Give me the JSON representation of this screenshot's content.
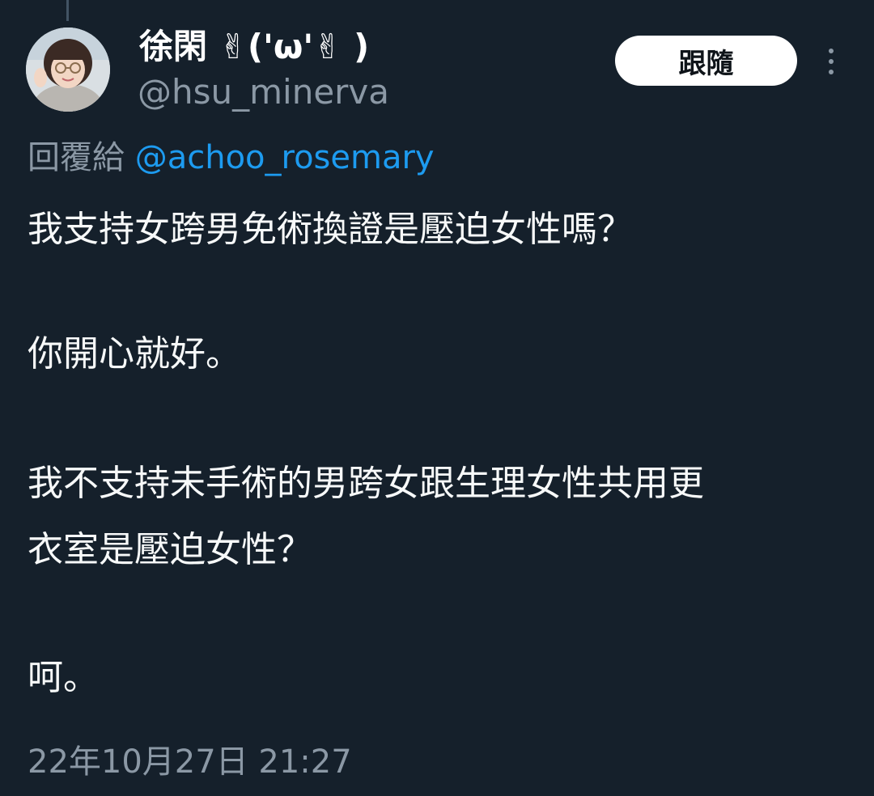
{
  "author": {
    "display_name": "徐閑 ✌('ω'✌ )",
    "handle": "@hsu_minerva",
    "avatar_icon": "user-avatar-photo"
  },
  "actions": {
    "follow_label": "跟隨",
    "more_icon": "more-vertical-icon"
  },
  "reply": {
    "prefix": "回覆給",
    "mention": "@achoo_rosemary"
  },
  "tweet": {
    "lines": [
      "我支持女跨男免術換證是壓迫女性嗎？",
      "你開心就好。",
      "我不支持未手術的男跨女跟生理女性共用更",
      "衣室是壓迫女性？",
      "呵。"
    ]
  },
  "timestamp": "22年10月27日 21:27",
  "colors": {
    "background": "#15202b",
    "text_primary": "#f7f9f9",
    "text_secondary": "#8b98a5",
    "link": "#1d9bf0",
    "button_bg": "#ffffff",
    "button_text": "#0f1419"
  }
}
